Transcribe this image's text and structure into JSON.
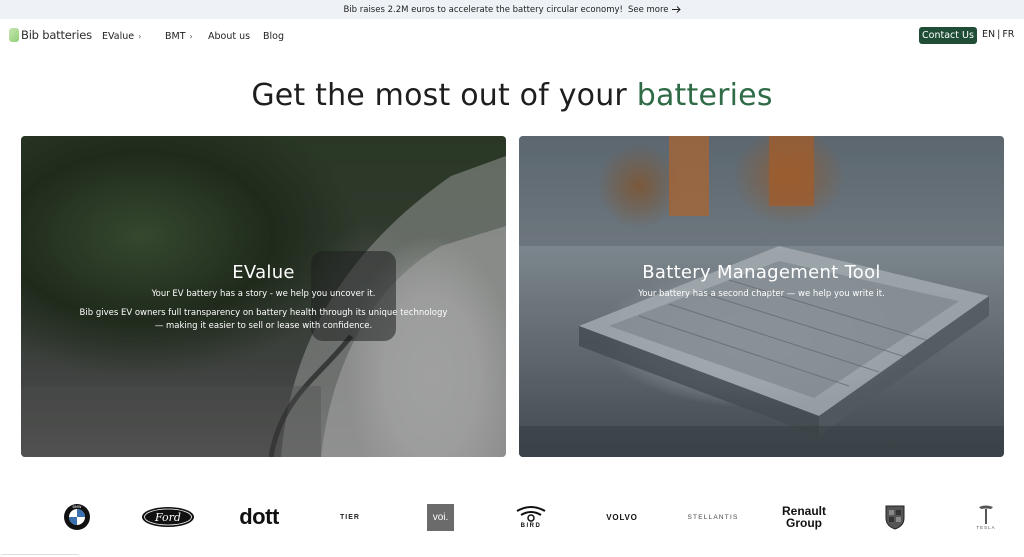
{
  "banner": {
    "text": "Bib raises 2.2M euros to accelerate the battery circular economy!",
    "link_label": "See more",
    "arrow_icon": "arrow-right-icon"
  },
  "nav": {
    "logo_text": "Bib batteries",
    "items": [
      {
        "label": "EValue",
        "has_dropdown": true
      },
      {
        "label": "BMT",
        "has_dropdown": true
      },
      {
        "label": "About us",
        "has_dropdown": false
      },
      {
        "label": "Blog",
        "has_dropdown": false
      }
    ],
    "contact_label": "Contact Us",
    "lang_en": "EN",
    "lang_sep": "|",
    "lang_fr": "FR"
  },
  "hero": {
    "title_main": "Get the most out of your ",
    "title_accent": "batteries",
    "accent_color": "#2f6b47"
  },
  "cards": [
    {
      "title": "EValue",
      "subtitle": "Your EV battery has a story - we help you uncover it.",
      "body_line1": "Bib gives EV owners full transparency on battery health through its unique technology",
      "body_line2": "— making it easier to sell or lease with confidence."
    },
    {
      "title": "Battery Management Tool",
      "subtitle": "Your battery has a second chapter — we help you write it."
    }
  ],
  "partners": {
    "bmw": "BMW",
    "ford": "Ford",
    "dott": "dott",
    "tier": "TIER",
    "voi": "voi.",
    "bird": "BIRD",
    "volvo": "VOLVO",
    "stellantis": "STELLANTIS",
    "renault_line1": "Renault",
    "renault_line2": "Group",
    "porsche": "Porsche",
    "tesla": "TESLA"
  },
  "colors": {
    "contact_bg": "#1f4d36",
    "banner_bg": "#eef2f6"
  }
}
